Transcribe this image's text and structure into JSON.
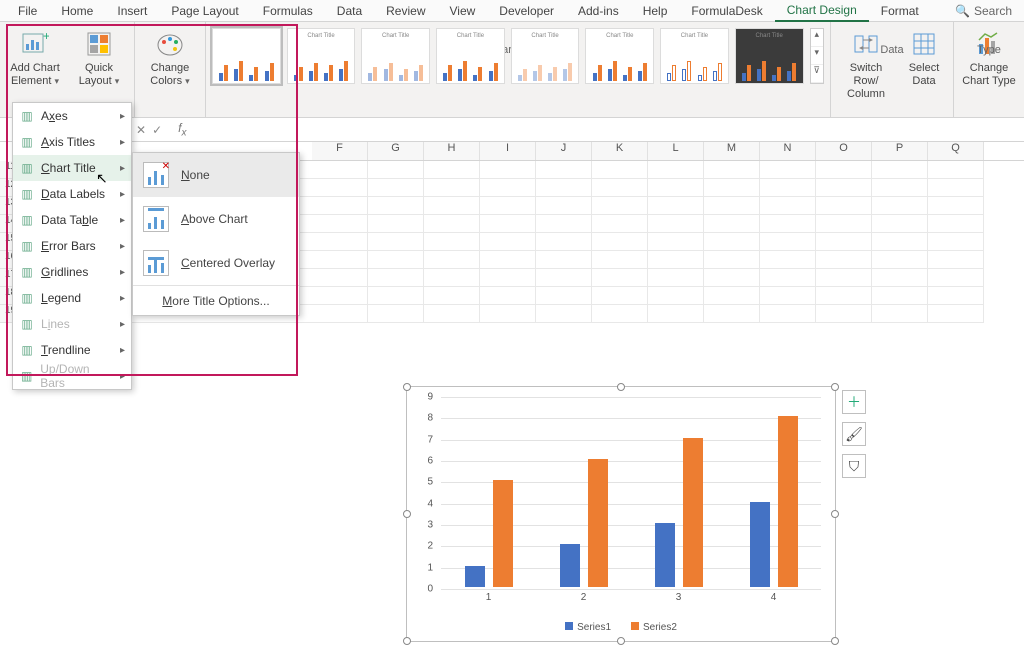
{
  "menu": {
    "items": [
      "File",
      "Home",
      "Insert",
      "Page Layout",
      "Formulas",
      "Data",
      "Review",
      "View",
      "Developer",
      "Add-ins",
      "Help",
      "FormulaDesk",
      "Chart Design",
      "Format"
    ],
    "active": "Chart Design",
    "search": "Search"
  },
  "ribbon": {
    "addChartElement": "Add Chart\nElement",
    "quickLayout": "Quick\nLayout",
    "changeColors": "Change\nColors",
    "chartStylesLabel": "Chart Styles",
    "switchRowCol": "Switch Row/\nColumn",
    "selectData": "Select\nData",
    "dataLabel": "Data",
    "changeChartType": "Change\nChart Type",
    "typeLabel": "Type",
    "styleThumbTitle": "Chart Title"
  },
  "aceMenu": {
    "items": [
      {
        "label": "Axes",
        "u": "x",
        "disabled": false
      },
      {
        "label": "Axis Titles",
        "u": "A",
        "disabled": false
      },
      {
        "label": "Chart Title",
        "u": "C",
        "disabled": false,
        "hover": true
      },
      {
        "label": "Data Labels",
        "u": "D",
        "disabled": false
      },
      {
        "label": "Data Table",
        "u": "b",
        "disabled": false
      },
      {
        "label": "Error Bars",
        "u": "E",
        "disabled": false
      },
      {
        "label": "Gridlines",
        "u": "G",
        "disabled": false
      },
      {
        "label": "Legend",
        "u": "L",
        "disabled": false
      },
      {
        "label": "Lines",
        "u": "i",
        "disabled": true
      },
      {
        "label": "Trendline",
        "u": "T",
        "disabled": false
      },
      {
        "label": "Up/Down Bars",
        "u": "U",
        "disabled": true
      }
    ]
  },
  "ctSub": {
    "none": "None",
    "above": "Above Chart",
    "centered": "Centered Overlay",
    "more": "More Title Options..."
  },
  "columns": [
    "F",
    "G",
    "H",
    "I",
    "J",
    "K",
    "L",
    "M",
    "N",
    "O",
    "P",
    "Q"
  ],
  "rowStart": 11,
  "rowEnd": 19,
  "chart_data": {
    "type": "bar",
    "categories": [
      "1",
      "2",
      "3",
      "4"
    ],
    "series": [
      {
        "name": "Series1",
        "values": [
          1,
          2,
          3,
          4
        ],
        "color": "#4472c4"
      },
      {
        "name": "Series2",
        "values": [
          5,
          6,
          7,
          8
        ],
        "color": "#ed7d31"
      }
    ],
    "ylim": [
      0,
      9
    ],
    "yticks": [
      0,
      1,
      2,
      3,
      4,
      5,
      6,
      7,
      8,
      9
    ]
  },
  "sideButtons": {
    "plus": "＋",
    "brush": "🖌",
    "funnel": "⛉"
  }
}
